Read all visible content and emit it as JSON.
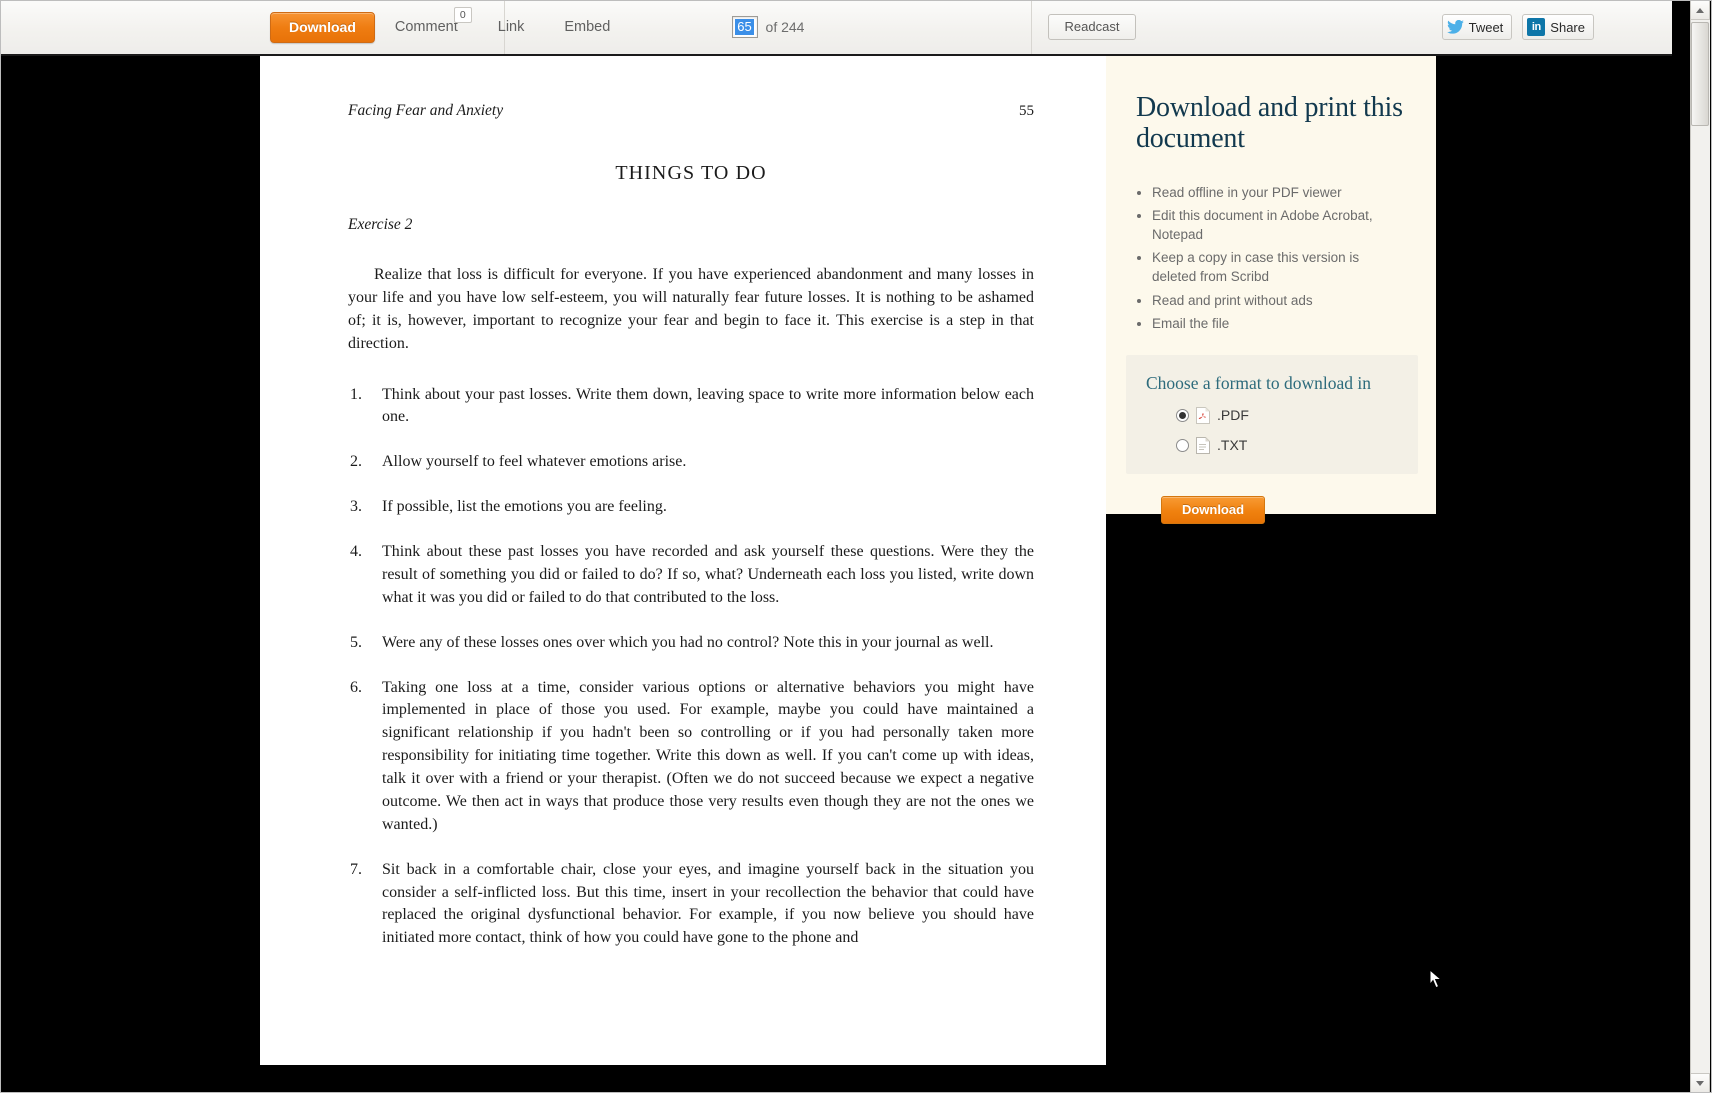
{
  "toolbar": {
    "download_label": "Download",
    "comment_label": "Comment",
    "comment_count": "0",
    "link_label": "Link",
    "embed_label": "Embed",
    "page_current": "65",
    "page_total": "of 244",
    "readcast_label": "Readcast",
    "tweet_label": "Tweet",
    "share_label": "Share",
    "linkedin_mark": "in"
  },
  "document": {
    "running_head": "Facing Fear and Anxiety",
    "page_number": "55",
    "heading": "THINGS TO DO",
    "exercise_label": "Exercise 2",
    "intro_paragraph": "Realize that loss is difficult for everyone. If you have experienced abandonment and many losses in your life and you have low self-esteem, you will naturally fear future losses. It is nothing to be ashamed of; it is, however, important to recognize your fear and begin to face it. This exercise is a step in that direction.",
    "items": [
      {
        "num": "1.",
        "text": "Think about your past losses. Write them down, leaving space to write more information below each one."
      },
      {
        "num": "2.",
        "text": "Allow yourself to feel whatever emotions arise."
      },
      {
        "num": "3.",
        "text": "If possible, list the emotions you are feeling."
      },
      {
        "num": "4.",
        "text": "Think about these past losses you have recorded and ask yourself these questions. Were they the result of something you did or failed to do? If so, what? Underneath each loss you listed, write down what it was you did or failed to do that contributed to the loss."
      },
      {
        "num": "5.",
        "text": "Were any of these losses ones over which you had no control? Note this in your journal as well."
      },
      {
        "num": "6.",
        "text": "Taking one loss at a time, consider various options or alternative behaviors you might have implemented in place of those you used. For example, maybe you could have maintained a significant relationship if you hadn't been so controlling or if you had personally taken more responsibility for initiating time together. Write this down as well. If you can't come up with ideas, talk it over with a friend or your therapist. (Often we do not succeed because we expect a negative outcome. We then act in ways that produce those very results even though they are not the ones we wanted.)"
      },
      {
        "num": "7.",
        "text": "Sit back in a comfortable chair, close your eyes, and imagine yourself back in the situation you consider a self-inflicted loss. But this time, insert in your recollection the behavior that could have replaced the original dysfunctional behavior. For example, if you now believe you should have initiated more contact, think of how you could have gone to the phone and"
      }
    ]
  },
  "download_panel": {
    "title": "Download and print this document",
    "bullets": [
      "Read offline in your PDF viewer",
      "Edit this document in Adobe Acrobat, Notepad",
      "Keep a copy in case this version is deleted from Scribd",
      "Read and print without ads",
      "Email the file"
    ],
    "format_label": "Choose a format to download in",
    "formats": [
      {
        "label": ".PDF",
        "selected": true,
        "icon": "pdf-icon"
      },
      {
        "label": ".TXT",
        "selected": false,
        "icon": "txt-icon"
      }
    ],
    "download_label": "Download"
  },
  "colors": {
    "accent_orange": "#ef7d12",
    "panel_cream": "#fdf9ec",
    "panel_title_blue": "#12394e",
    "format_teal": "#2d6b7c",
    "selection_blue": "#3b8fe8",
    "linkedin_blue": "#0e76a8"
  }
}
